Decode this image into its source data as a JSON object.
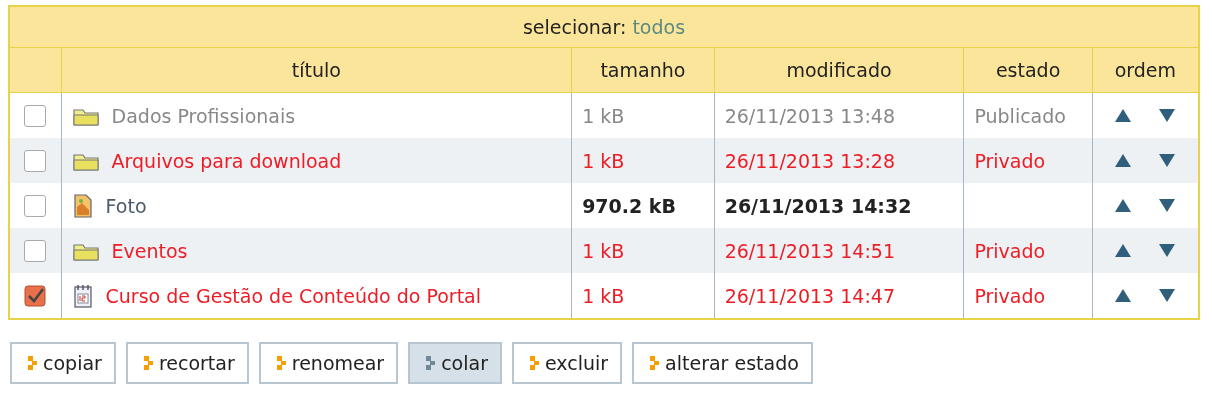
{
  "select_bar": {
    "label": "selecionar:",
    "link": "todos"
  },
  "columns": [
    "título",
    "tamanho",
    "modificado",
    "estado",
    "ordem"
  ],
  "rows": [
    {
      "kind": "folder",
      "title": "Dados Profissionais",
      "size": "1 kB",
      "modified": "26/11/2013 13:48",
      "color": "#888888",
      "bold": false,
      "state_label": "Publicado",
      "checked": false
    },
    {
      "kind": "folder",
      "title": "Arquivos para download",
      "size": "1 kB",
      "modified": "26/11/2013 13:28",
      "color": "#ee1c25",
      "bold": false,
      "state_label": "Privado",
      "checked": false
    },
    {
      "kind": "image",
      "title": "Foto",
      "size": "970.2 kB",
      "modified": "26/11/2013 14:32",
      "color": "#222222",
      "bold": true,
      "checked": false
    },
    {
      "kind": "folder",
      "title": "Eventos",
      "size": "1 kB",
      "modified": "26/11/2013 14:51",
      "color": "#ee1c25",
      "bold": false,
      "state_label": "Privado",
      "checked": false
    },
    {
      "kind": "event",
      "title": "Curso de Gestão de Conteúdo do Portal",
      "size": "1 kB",
      "modified": "26/11/2013 14:47",
      "color": "#ee1c25",
      "bold": false,
      "state_label": "Privado",
      "checked": true
    }
  ],
  "buttons": [
    {
      "label": "copiar",
      "highlighted": false
    },
    {
      "label": "recortar",
      "highlighted": false
    },
    {
      "label": "renomear",
      "highlighted": false
    },
    {
      "label": "colar",
      "highlighted": true
    },
    {
      "label": "excluir",
      "highlighted": false
    },
    {
      "label": "alterar estado",
      "highlighted": false
    }
  ]
}
